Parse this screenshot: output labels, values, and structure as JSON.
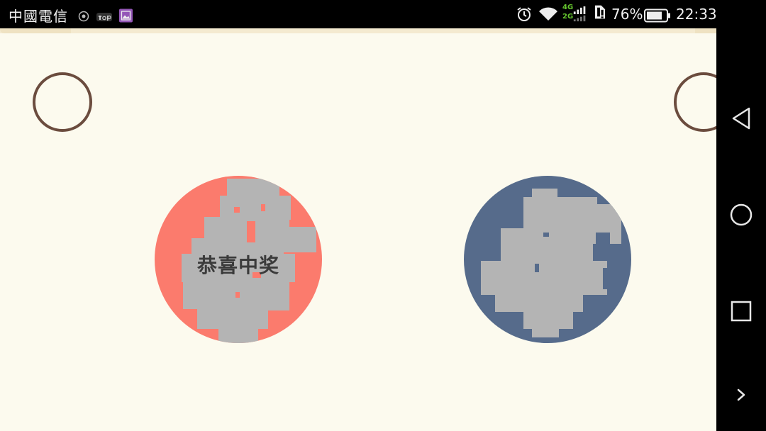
{
  "status_bar": {
    "carrier": "中國電信",
    "network_top": "4G",
    "network_bottom": "2G",
    "battery_percent": "76%",
    "time": "22:33",
    "icons": [
      "qq-icon",
      "tap-icon",
      "gallery-icon",
      "alarm-icon",
      "wifi-icon",
      "signal-icon",
      "sim-alert-icon",
      "battery-icon"
    ]
  },
  "game": {
    "prize_text": "恭喜中奖",
    "left_card_color": "#fb7b6d",
    "right_card_color": "#566b8b",
    "scratch_coating_color": "#b4b4b4",
    "ring_color": "#6b4c3e",
    "background_color": "#fcfaee"
  },
  "nav_bar": {
    "buttons": [
      "back-icon",
      "home-icon",
      "recents-icon",
      "more-icon"
    ]
  }
}
